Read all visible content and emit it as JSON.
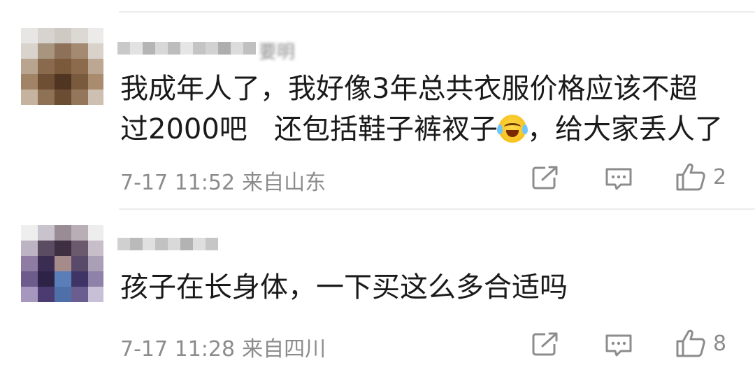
{
  "comments": [
    {
      "username_tail": "要明",
      "lines": [
        "我成年人了，我好像3年总共衣服价格应该不超",
        "过2000吧   还包括鞋子裤衩子"
      ],
      "line2_suffix": "，给大家丢人了",
      "emoji": "laugh-cry-emoji",
      "time": "7-17 11:52",
      "location": "来自山东",
      "likes": "2"
    },
    {
      "lines": [
        "孩子在长身体，一下买这么多合适吗"
      ],
      "time": "7-17 11:28",
      "location": "来自四川",
      "likes": "8"
    }
  ],
  "icons": {
    "share": "share-icon",
    "reply": "comment-icon",
    "like": "thumbs-up-icon"
  },
  "colors": {
    "text": "#1a1a1a",
    "meta": "#8c8c8c",
    "divider": "#ececec",
    "icon": "#8c8c8c"
  }
}
